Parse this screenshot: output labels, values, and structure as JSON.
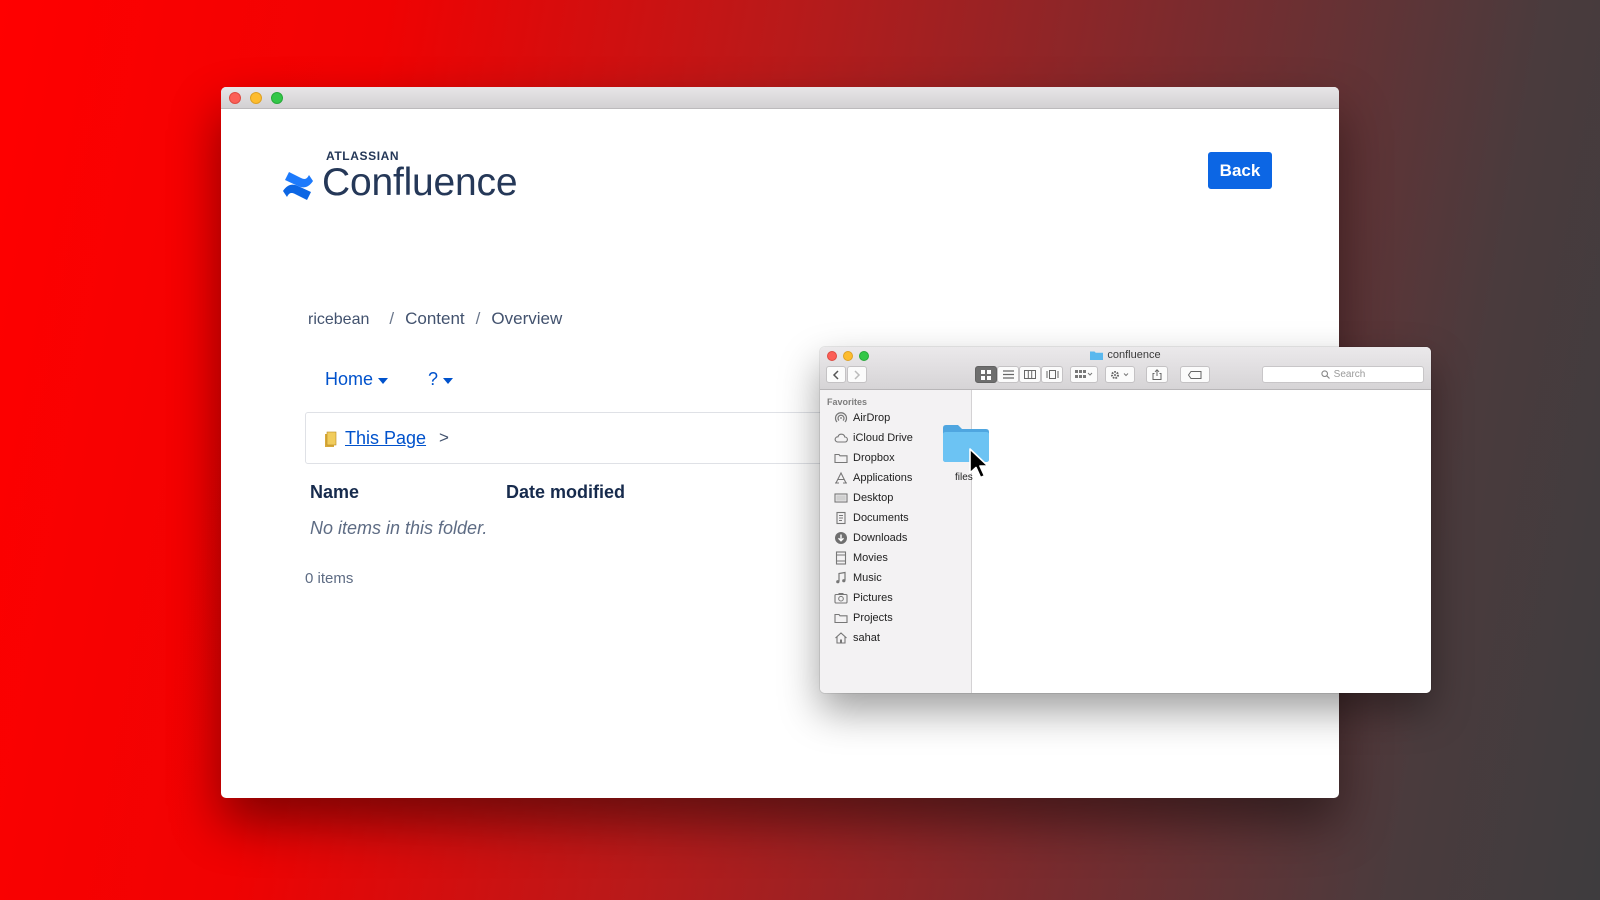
{
  "browser": {
    "logo": {
      "brand": "ATLASSIAN",
      "product": "Confluence",
      "color": "#253858",
      "icon_color": "#0c66e4"
    },
    "back_label": "Back",
    "accent": "#0c66e4",
    "breadcrumb": [
      "ricebean",
      "Content",
      "Overview"
    ],
    "breadcrumb_sep": "/",
    "nav": {
      "home": "Home",
      "help": "?"
    },
    "path": {
      "link": "This Page",
      "chevron": ">"
    },
    "columns": {
      "name": "Name",
      "date": "Date modified"
    },
    "empty_message": "No items in this folder.",
    "count": "0 items"
  },
  "finder": {
    "title": "confluence",
    "search_placeholder": "Search",
    "favorites_label": "Favorites",
    "items": [
      {
        "label": "AirDrop",
        "icon": "airdrop-icon"
      },
      {
        "label": "iCloud Drive",
        "icon": "cloud-icon"
      },
      {
        "label": "Dropbox",
        "icon": "folder-icon"
      },
      {
        "label": "Applications",
        "icon": "applications-icon"
      },
      {
        "label": "Desktop",
        "icon": "desktop-icon"
      },
      {
        "label": "Documents",
        "icon": "documents-icon"
      },
      {
        "label": "Downloads",
        "icon": "downloads-icon"
      },
      {
        "label": "Movies",
        "icon": "movies-icon"
      },
      {
        "label": "Music",
        "icon": "music-icon"
      },
      {
        "label": "Pictures",
        "icon": "pictures-icon"
      },
      {
        "label": "Projects",
        "icon": "folder-icon"
      },
      {
        "label": "sahat",
        "icon": "home-icon"
      }
    ],
    "file": {
      "name": "files",
      "icon": "folder-icon",
      "color": "#5ab8ee"
    }
  }
}
